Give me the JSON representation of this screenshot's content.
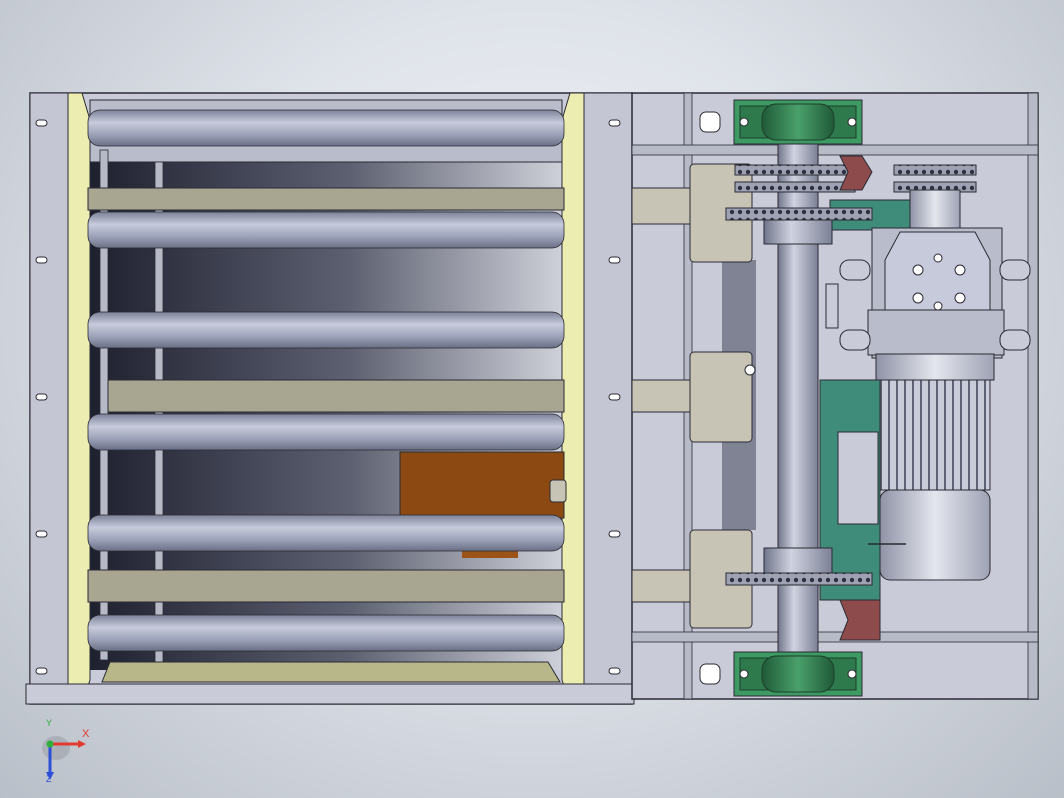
{
  "app": {
    "title": "",
    "view": "Top"
  },
  "triad": {
    "x_label": "X",
    "y_label": "Y",
    "z_label": "Z",
    "x_color": "#e33a2f",
    "y_color": "#2fae3a",
    "z_color": "#2b4fd6"
  },
  "colors": {
    "frame": "#c9ccd8",
    "frame_edge": "#2a2a33",
    "roller": "#9da2b8",
    "liner": "#ecedb0",
    "crossbar": "#a8a590",
    "bracket": "#c7c4b6",
    "motor": "#a9adbf",
    "bearing": "#2f7a4c",
    "sprocket": "#7a7f92",
    "plate": "#3f8c7a",
    "block": "#8c4a12"
  },
  "icons": {
    "triad": "axis-triad-icon"
  }
}
